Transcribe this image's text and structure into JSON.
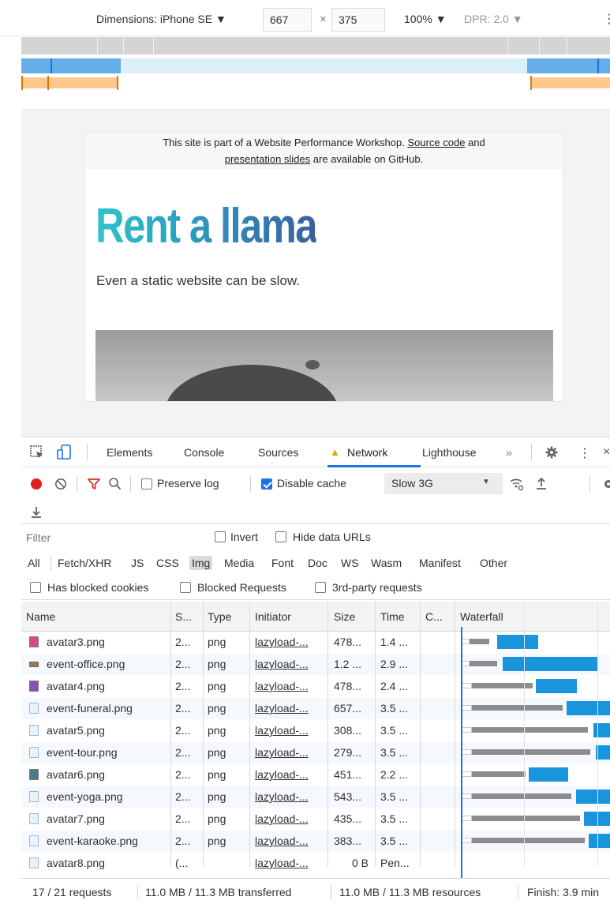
{
  "device_toolbar": {
    "dimensions_label": "Dimensions: iPhone SE ▼",
    "width": "667",
    "times": "×",
    "height": "375",
    "zoom": "100% ▼",
    "dpr": "DPR: 2.0 ▼",
    "more": "⋮"
  },
  "page": {
    "notice_pre": "This site is part of a Website Performance Workshop. ",
    "notice_link1": "Source code",
    "notice_mid": " and",
    "notice_link2": "presentation slides",
    "notice_post": " are available on GitHub.",
    "title": "Rent a llama",
    "subtitle": "Even a static website can be slow."
  },
  "devtools": {
    "tabs": [
      "Elements",
      "Console",
      "Sources",
      "Network",
      "Lighthouse",
      "»"
    ],
    "active_tab": "Network",
    "warning_glyph": "▲",
    "preserve_log": "Preserve log",
    "disable_cache": "Disable cache",
    "throttle": "Slow 3G",
    "filter_placeholder": "Filter",
    "invert": "Invert",
    "hide_data_urls": "Hide data URLs",
    "type_filters": [
      "All",
      "Fetch/XHR",
      "JS",
      "CSS",
      "Img",
      "Media",
      "Font",
      "Doc",
      "WS",
      "Wasm",
      "Manifest",
      "Other"
    ],
    "selected_type": "Img",
    "blocked": [
      "Has blocked cookies",
      "Blocked Requests",
      "3rd-party requests"
    ],
    "columns": [
      "Name",
      "S...",
      "Type",
      "Initiator",
      "Size",
      "Time",
      "C...",
      "Waterfall"
    ],
    "rows": [
      {
        "name": "avatar3.png",
        "status": "2...",
        "type": "png",
        "initiator": "lazyload-...",
        "size": "478...",
        "time": "1.4 ...",
        "icon": "avatar-thumb-icon"
      },
      {
        "name": "event-office.png",
        "status": "2...",
        "type": "png",
        "initiator": "lazyload-...",
        "size": "1.2 ...",
        "time": "2.9 ...",
        "icon": "image-thumb-icon"
      },
      {
        "name": "avatar4.png",
        "status": "2...",
        "type": "png",
        "initiator": "lazyload-...",
        "size": "478...",
        "time": "2.4 ...",
        "icon": "avatar-thumb-icon"
      },
      {
        "name": "event-funeral.png",
        "status": "2...",
        "type": "png",
        "initiator": "lazyload-...",
        "size": "657...",
        "time": "3.5 ...",
        "icon": "file-icon"
      },
      {
        "name": "avatar5.png",
        "status": "2...",
        "type": "png",
        "initiator": "lazyload-...",
        "size": "308...",
        "time": "3.5 ...",
        "icon": "file-icon"
      },
      {
        "name": "event-tour.png",
        "status": "2...",
        "type": "png",
        "initiator": "lazyload-...",
        "size": "279...",
        "time": "3.5 ...",
        "icon": "file-icon"
      },
      {
        "name": "avatar6.png",
        "status": "2...",
        "type": "png",
        "initiator": "lazyload-...",
        "size": "451...",
        "time": "2.2 ...",
        "icon": "avatar-thumb-icon"
      },
      {
        "name": "event-yoga.png",
        "status": "2...",
        "type": "png",
        "initiator": "lazyload-...",
        "size": "543...",
        "time": "3.5 ...",
        "icon": "file-icon"
      },
      {
        "name": "avatar7.png",
        "status": "2...",
        "type": "png",
        "initiator": "lazyload-...",
        "size": "435...",
        "time": "3.5 ...",
        "icon": "file-icon"
      },
      {
        "name": "event-karaoke.png",
        "status": "2...",
        "type": "png",
        "initiator": "lazyload-...",
        "size": "383...",
        "time": "3.5 ...",
        "icon": "file-icon"
      },
      {
        "name": "avatar8.png",
        "status": "(...",
        "type": "",
        "initiator": "lazyload-...",
        "size": "0 B",
        "time": "Pen...",
        "icon": "file-icon"
      }
    ],
    "status_bar": {
      "requests": "17 / 21 requests",
      "transferred": "11.0 MB / 11.3 MB transferred",
      "resources": "11.0 MB / 11.3 MB resources",
      "finish": "Finish: 3.9 min"
    }
  }
}
